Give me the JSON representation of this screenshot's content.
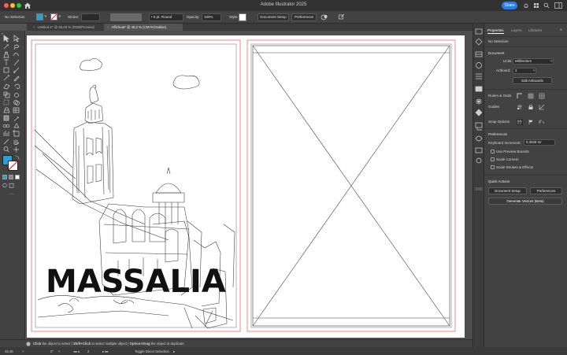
{
  "window": {
    "title": "Adobe Illustrator 2025",
    "share_label": "Share"
  },
  "control_bar": {
    "selection_label": "No Selection",
    "stroke_label": "Stroke:",
    "brush_value": "5 pt. Round",
    "opacity_label": "Opacity:",
    "opacity_value": "100%",
    "style_label": "Style:",
    "document_setup_label": "Document Setup",
    "preferences_label": "Preferences",
    "fill_color": "#26a0d8"
  },
  "tabs": [
    {
      "label": "Untitled-1* @ 66,48 % (RGB/Preview)",
      "close": "×"
    },
    {
      "label": "Affichuat* @ 48,2 % (CMYK/Outline)",
      "close": "×"
    }
  ],
  "artwork": {
    "headline": "MASSALIA"
  },
  "status": {
    "hint_click": "Click",
    "hint_text_1": " the object to select | ",
    "hint_shift": "Shift+Click",
    "hint_text_2": " to select multiple object | ",
    "hint_option": "Option+Drag",
    "hint_text_3": " the object to duplicate",
    "zoom": "48,36",
    "rotation": "0°",
    "artboard_num": "2",
    "tool_name": "Toggle Direct Selection"
  },
  "panel": {
    "tabs": [
      "Properties",
      "Layers",
      "Libraries"
    ],
    "selection": "No Selection",
    "document_heading": "Document",
    "units_label": "Units:",
    "units_value": "Millimeters",
    "artboard_label": "Artboard:",
    "artboard_value": "2",
    "edit_artboards_label": "Edit Artboards",
    "rulers_label": "Rulers & Grids",
    "guides_label": "Guides",
    "snap_label": "Snap Options",
    "preferences_heading": "Preferences",
    "keyboard_increment_label": "Keyboard Increment:",
    "keyboard_increment_value": "0,3528 mr",
    "checkboxes": [
      "Use Preview Bounds",
      "Scale Corners",
      "Scale Strokes & Effects"
    ],
    "quick_actions_heading": "Quick Actions",
    "document_setup_button": "Document Setup",
    "preferences_button": "Preferences",
    "generate_vectors_button": "Generate Vectors (Beta)"
  }
}
